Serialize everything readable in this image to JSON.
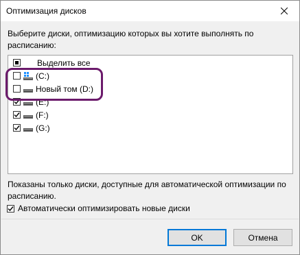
{
  "window": {
    "title": "Оптимизация дисков"
  },
  "instruction": "Выберите диски, оптимизацию которых вы хотите выполнять по расписанию:",
  "drives": {
    "select_all": {
      "label": "Выделить все",
      "state": "indeterminate"
    },
    "items": [
      {
        "label": "(C:)",
        "checked": false,
        "icon": "windows-drive-icon"
      },
      {
        "label": "Новый том (D:)",
        "checked": false,
        "icon": "drive-icon"
      },
      {
        "label": "(E:)",
        "checked": true,
        "icon": "drive-icon"
      },
      {
        "label": "(F:)",
        "checked": true,
        "icon": "drive-icon"
      },
      {
        "label": "(G:)",
        "checked": true,
        "icon": "drive-icon"
      }
    ]
  },
  "note": "Показаны только диски, доступные для автоматической оптимизации по расписанию.",
  "auto_optimize": {
    "label": "Автоматически оптимизировать новые диски",
    "checked": true
  },
  "buttons": {
    "ok": "OK",
    "cancel": "Отмена"
  },
  "colors": {
    "highlight": "#6b1a6b",
    "accent": "#0078d7"
  }
}
